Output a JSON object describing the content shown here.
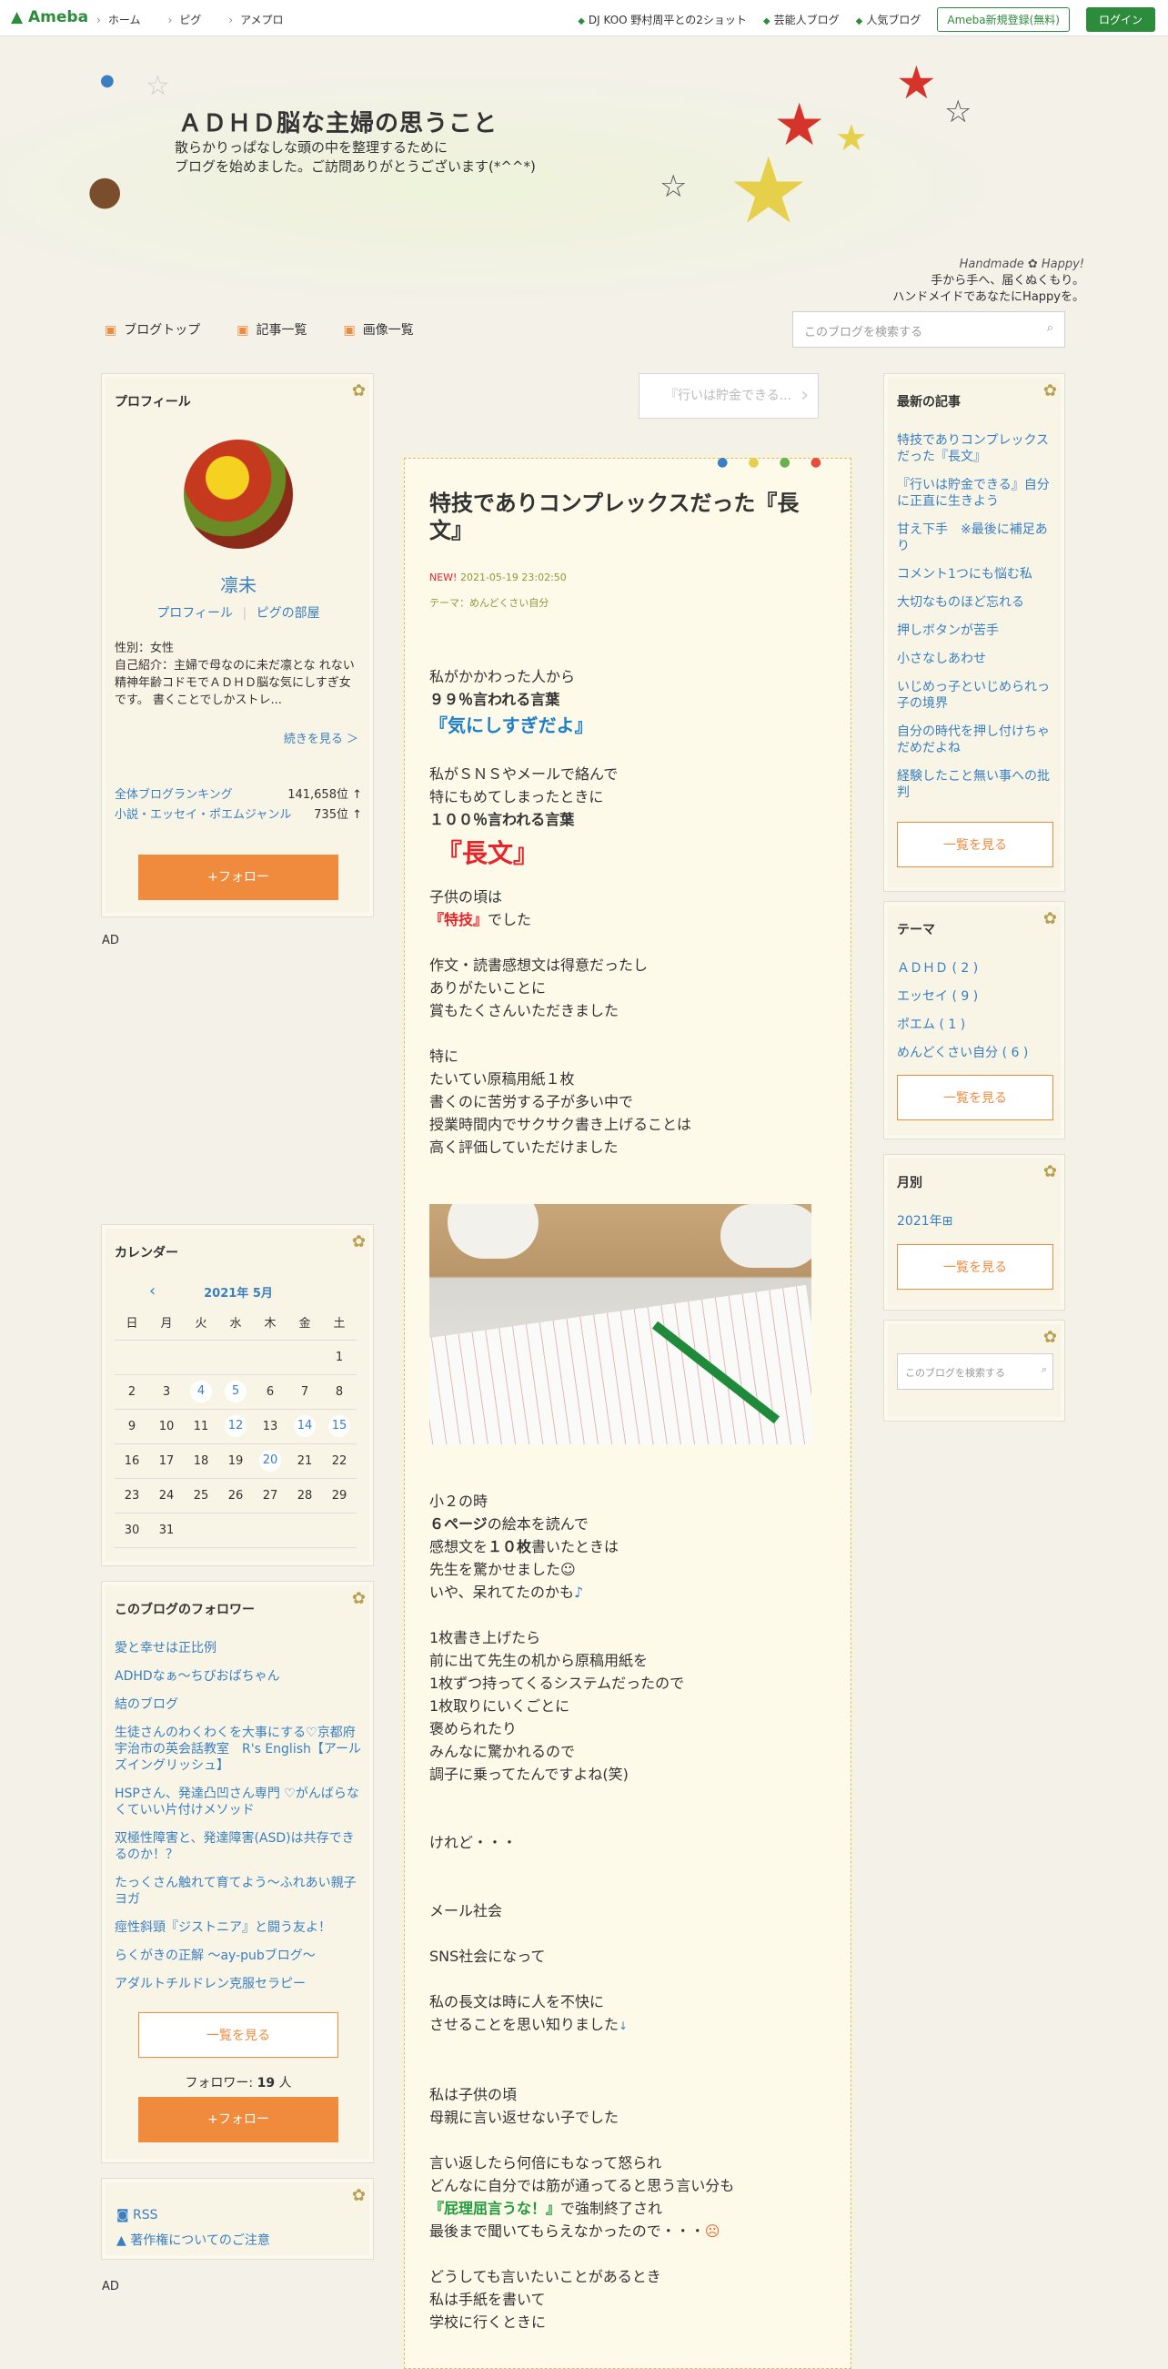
{
  "topbar": {
    "logo": "Ameba",
    "nav": [
      "ホーム",
      "ピグ",
      "アメプロ"
    ],
    "links": [
      "DJ KOO 野村周平との2ショット",
      "芸能人ブログ",
      "人気ブログ"
    ],
    "register": "Ameba新規登録(無料)",
    "login": "ログイン"
  },
  "header": {
    "title": "ＡＤＨＤ脳な主婦の思うこと",
    "desc1": "散らかりっぱなしな頭の中を整理するために",
    "desc2": "ブログを始めました。ご訪問ありがとうございます(*^^*)",
    "tag1": "Handmade ✿ Happy!",
    "tag2": "手から手へ、届くぬくもり。",
    "tag3": "ハンドメイドであなたにHappyを。"
  },
  "gnav": {
    "items": [
      "ブログトップ",
      "記事一覧",
      "画像一覧"
    ],
    "search_placeholder": "このブログを検索する"
  },
  "profile": {
    "heading": "プロフィール",
    "name": "凛未",
    "link1": "プロフィール",
    "link2": "ピグの部屋",
    "gender": "性別：女性",
    "intro": "自己紹介：主婦で母なのに未だ凛とな れない 精神年齢コドモでＡＤＨＤ脳な気にしすぎ女です。 書くことでしかストレ...",
    "more": "続きを見る ＞",
    "rank1_label": "全体ブログランキング",
    "rank1_value": "141,658位 ↑",
    "rank2_label": "小説・エッセイ・ポエムジャンル",
    "rank2_value": "735位 ↑",
    "follow": "+フォロー"
  },
  "ad1": "AD",
  "ad2": "AD",
  "calendar": {
    "heading": "カレンダー",
    "month": "2021年 5月",
    "weekdays": [
      "日",
      "月",
      "火",
      "水",
      "木",
      "金",
      "土"
    ],
    "rows": [
      [
        "",
        "",
        "",
        "",
        "",
        "",
        "1"
      ],
      [
        "2",
        "3",
        "4",
        "5",
        "6",
        "7",
        "8"
      ],
      [
        "9",
        "10",
        "11",
        "12",
        "13",
        "14",
        "15"
      ],
      [
        "16",
        "17",
        "18",
        "19",
        "20",
        "21",
        "22"
      ],
      [
        "23",
        "24",
        "25",
        "26",
        "27",
        "28",
        "29"
      ],
      [
        "30",
        "31",
        "",
        "",
        "",
        "",
        ""
      ]
    ],
    "highlighted": [
      "4",
      "5",
      "12",
      "14",
      "15",
      "20"
    ]
  },
  "followers": {
    "heading": "このブログのフォロワー",
    "items": [
      "愛と幸せは正比例",
      "ADHDなぁ～ちびおばちゃん",
      "結のブログ",
      "生徒さんのわくわくを大事にする♡京都府宇治市の英会話教室　R's English【アールズイングリッシュ】",
      "HSPさん、発達凸凹さん専門 ♡がんばらなくていい片付けメソッド",
      "双極性障害と、発達障害(ASD)は共存できるのか！？",
      "たっくさん触れて育てよう～ふれあい親子ヨガ",
      "痙性斜頸『ジストニア』と闘う友よ！",
      "らくがきの正解 〜ay-pubブログ〜",
      "アダルトチルドレン克服セラピー"
    ],
    "more": "一覧を見る",
    "count_label": "フォロワー: ",
    "count": "19",
    "count_unit": " 人",
    "follow": "+フォロー"
  },
  "rss": {
    "rss": "RSS",
    "copyright": "著作権についてのご注意"
  },
  "next_article": "『行いは貯金できる...",
  "article": {
    "title": "特技でありコンプレックスだった『長文』",
    "new": "NEW!",
    "date": "2021-05-19 23:02:50",
    "theme": "テーマ：めんどくさい自分",
    "p1a": "私がかかわった人から",
    "p1b": "９９％言われる言葉",
    "p1c": "『気にしすぎだよ』",
    "p2a": "私がＳＮＳやメールで絡んで",
    "p2b": "特にもめてしまったときに",
    "p2c": "１００％言われる言葉",
    "p2d": "『長文』",
    "p3a": "子供の頃は",
    "p3b": "『特技』",
    "p3c": "でした",
    "p4a": "作文・読書感想文は得意だったし",
    "p4b": "ありがたいことに",
    "p4c": "賞もたくさんいただきました",
    "p5a": "特に",
    "p5b": "たいてい原稿用紙１枚",
    "p5c": "書くのに苦労する子が多い中で",
    "p5d": "授業時間内でサクサク書き上げることは",
    "p5e": "高く評価していただけました",
    "p6a": "小２の時",
    "p6b": "６ページ",
    "p6c": "の絵本を読んで",
    "p6d": "感想文を",
    "p6e": "１０枚",
    "p6f": "書いたときは",
    "p6g": "先生を驚かせました",
    "p6h": "いや、呆れてたのかも",
    "p7a": "1枚書き上げたら",
    "p7b": "前に出て先生の机から原稿用紙を",
    "p7c": "1枚ずつ持ってくるシステムだったので",
    "p7d": "1枚取りにいくごとに",
    "p7e": "褒められたり",
    "p7f": "みんなに驚かれるので",
    "p7g": "調子に乗ってたんですよね(笑)",
    "p8": "けれど・・・",
    "p9": "メール社会",
    "p10": "SNS社会になって",
    "p11a": "私の長文は時に人を不快に",
    "p11b": "させることを思い知りました",
    "p12a": "私は子供の頃",
    "p12b": "母親に言い返せない子でした",
    "p13a": "言い返したら何倍にもなって怒られ",
    "p13b": "どんなに自分では筋が通ってると思う言い分も",
    "p13c": "『屁理屈言うな！』",
    "p13d": "で強制終了され",
    "p13e": "最後まで聞いてもらえなかったので・・・",
    "p14a": "どうしても言いたいことがあるとき",
    "p14b": "私は手紙を書いて",
    "p14c": "学校に行くときに"
  },
  "latest": {
    "heading": "最新の記事",
    "items": [
      "特技でありコンプレックスだった『長文』",
      "『行いは貯金できる』自分に正直に生きよう",
      "甘え下手　※最後に補足あり",
      "コメント1つにも悩む私",
      "大切なものほど忘れる",
      "押しボタンが苦手",
      "小さなしあわせ",
      "いじめっ子といじめられっ子の境界",
      "自分の時代を押し付けちゃだめだよね",
      "経験したこと無い事への批判"
    ],
    "more": "一覧を見る"
  },
  "themes": {
    "heading": "テーマ",
    "items": [
      "ＡＤＨＤ ( 2 )",
      "エッセイ ( 9 )",
      "ポエム ( 1 )",
      "めんどくさい自分 ( 6 )"
    ],
    "more": "一覧を見る"
  },
  "monthly": {
    "heading": "月別",
    "items": [
      "2021年⊞"
    ],
    "more": "一覧を見る"
  },
  "side_search": {
    "placeholder": "このブログを検索する"
  },
  "colors": {
    "accent": "#f08a3c",
    "link": "#3a7fc1",
    "ameba": "#2d8c3c",
    "title_red": "#e8232a",
    "blue_quote": "#1e7ec8"
  }
}
